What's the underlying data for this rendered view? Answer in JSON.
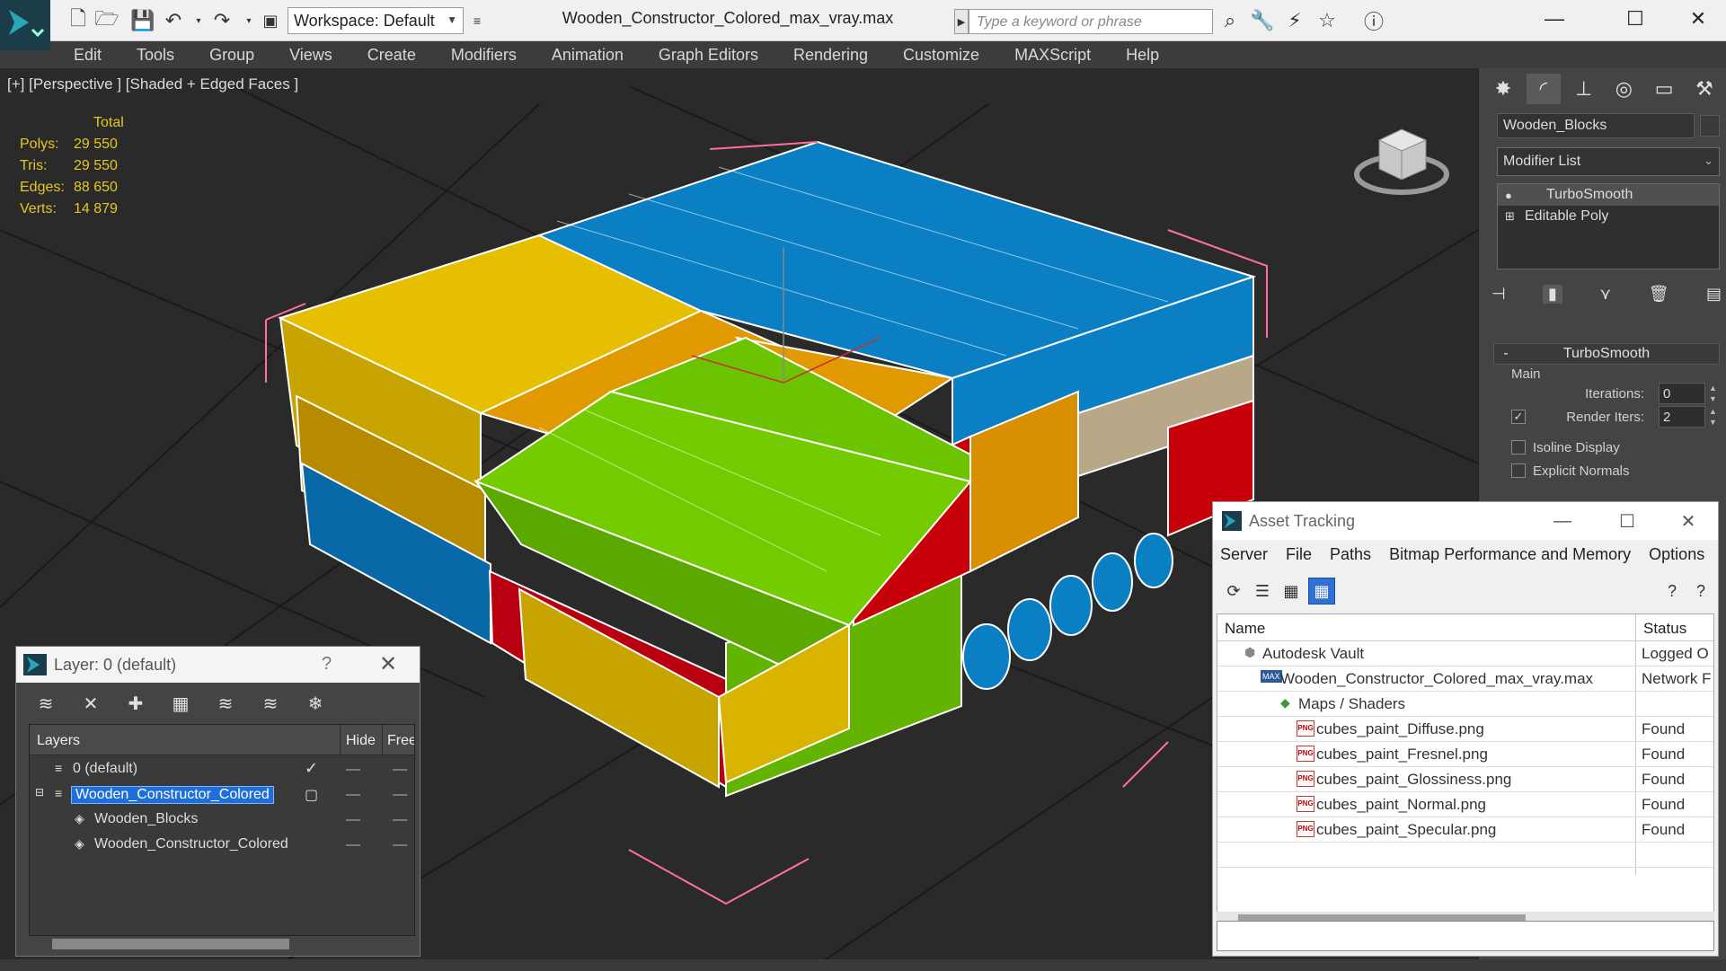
{
  "titlebar": {
    "workspace": "Workspace: Default",
    "document_title": "Wooden_Constructor_Colored_max_vray.max",
    "search_placeholder": "Type a keyword or phrase"
  },
  "menubar": {
    "items": [
      "Edit",
      "Tools",
      "Group",
      "Views",
      "Create",
      "Modifiers",
      "Animation",
      "Graph Editors",
      "Rendering",
      "Customize",
      "MAXScript",
      "Help"
    ]
  },
  "viewport": {
    "label": "[+] [Perspective ] [Shaded + Edged Faces ]",
    "stats": {
      "header": "Total",
      "polys_label": "Polys:",
      "polys": "29 550",
      "tris_label": "Tris:",
      "tris": "29 550",
      "edges_label": "Edges:",
      "edges": "88 650",
      "verts_label": "Verts:",
      "verts": "14 879"
    },
    "colors": {
      "blue": "#0a7fc4",
      "yellow": "#e6c000",
      "orange": "#e09a00",
      "green": "#6cc400",
      "red": "#c8000a",
      "beige": "#b8a888",
      "background": "#2a2a2a"
    }
  },
  "command_panel": {
    "object_name": "Wooden_Blocks",
    "modifier_list": "Modifier List",
    "stack": [
      "TurboSmooth",
      "Editable Poly"
    ],
    "rollout_title": "TurboSmooth",
    "main_label": "Main",
    "iterations_label": "Iterations:",
    "iterations": "0",
    "render_iters_label": "Render Iters:",
    "render_iters": "2",
    "isoline_label": "Isoline Display",
    "explicit_normals_label": "Explicit Normals"
  },
  "layer_dialog": {
    "title": "Layer: 0 (default)",
    "help": "?",
    "col_layers": "Layers",
    "col_hide": "Hide",
    "col_freeze": "Freez",
    "rows": [
      {
        "name": "0 (default)"
      },
      {
        "name": "Wooden_Constructor_Colored"
      },
      {
        "name": "Wooden_Blocks"
      },
      {
        "name": "Wooden_Constructor_Colored"
      }
    ]
  },
  "asset_dialog": {
    "title": "Asset Tracking",
    "menu": [
      "Server",
      "File",
      "Paths",
      "Bitmap Performance and Memory",
      "Options"
    ],
    "col_name": "Name",
    "col_status": "Status",
    "rows": [
      {
        "name": "Autodesk Vault",
        "status": "Logged O"
      },
      {
        "name": "Wooden_Constructor_Colored_max_vray.max",
        "status": "Network F"
      },
      {
        "name": "Maps / Shaders",
        "status": ""
      },
      {
        "name": "cubes_paint_Diffuse.png",
        "status": "Found"
      },
      {
        "name": "cubes_paint_Fresnel.png",
        "status": "Found"
      },
      {
        "name": "cubes_paint_Glossiness.png",
        "status": "Found"
      },
      {
        "name": "cubes_paint_Normal.png",
        "status": "Found"
      },
      {
        "name": "cubes_paint_Specular.png",
        "status": "Found"
      }
    ]
  }
}
